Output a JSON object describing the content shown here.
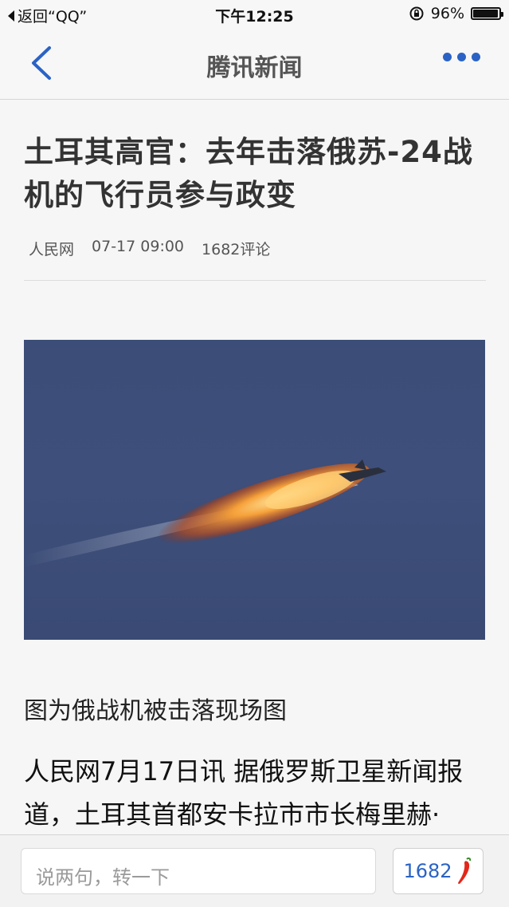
{
  "status_bar": {
    "back_app": "返回“QQ”",
    "time": "下午12:25",
    "battery": "96%",
    "battery_level": 0.96
  },
  "nav": {
    "title": "腾讯新闻",
    "back_icon": "chevron-left-icon",
    "more_icon": "more-dots-icon",
    "accent": "#2a63c5"
  },
  "article": {
    "headline": "土耳其高官：去年击落俄苏-24战机的飞行员参与政变",
    "source": "人民网",
    "datetime": "07-17 09:00",
    "comments": "1682评论",
    "caption": "图为俄战机被击落现场图",
    "body": "人民网7月17日讯 据俄罗斯卫星新闻报道，土耳其首都安卡拉市市长梅里赫·"
  },
  "bottom_bar": {
    "input_placeholder": "说两句，转一下",
    "comment_count": "1682",
    "comment_icon": "chili-pepper-icon"
  }
}
